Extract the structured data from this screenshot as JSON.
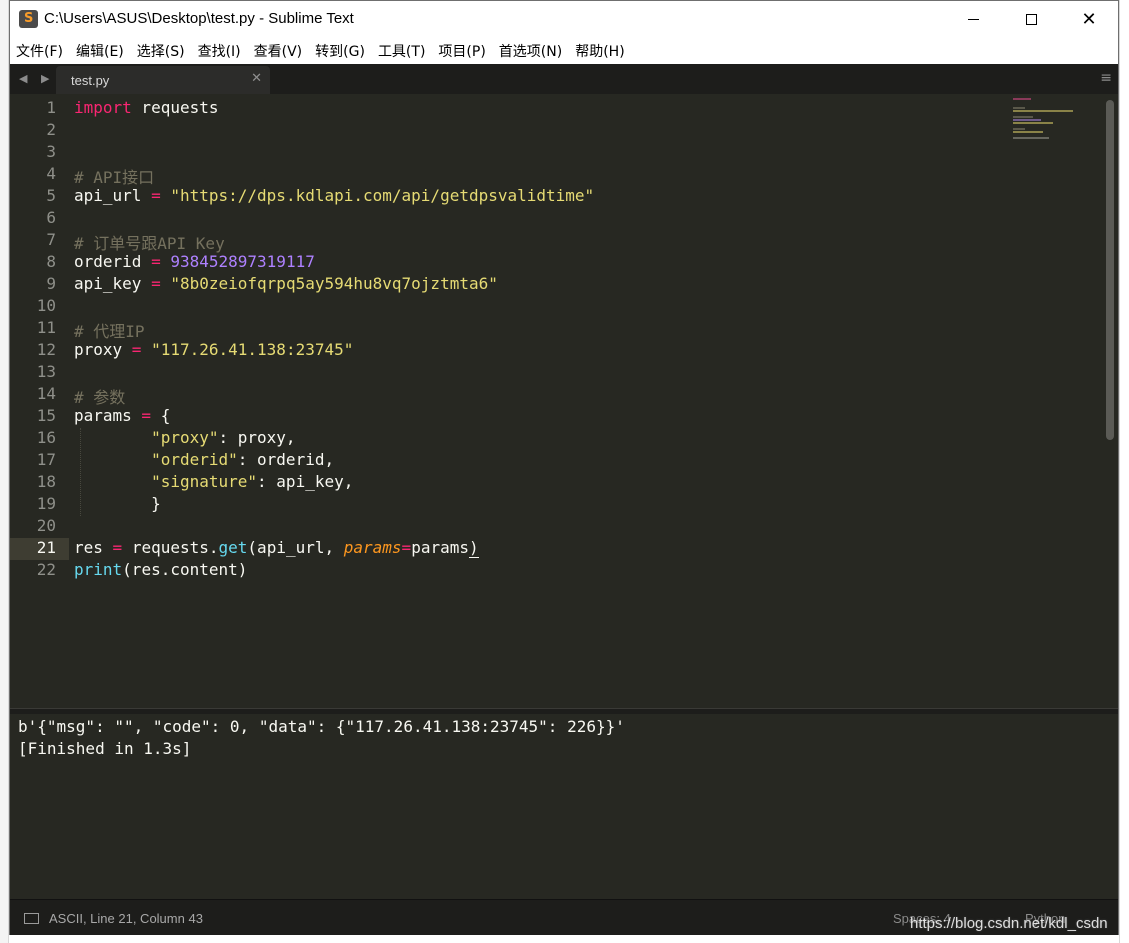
{
  "window": {
    "title": "C:\\Users\\ASUS\\Desktop\\test.py - Sublime Text",
    "minimize_glyph": "",
    "maximize_glyph": "",
    "close_glyph": "✕"
  },
  "menu": [
    "文件(F)",
    "编辑(E)",
    "选择(S)",
    "查找(I)",
    "查看(V)",
    "转到(G)",
    "工具(T)",
    "项目(P)",
    "首选项(N)",
    "帮助(H)"
  ],
  "tabs": {
    "nav_glyph": "◀ ▶",
    "active_label": "test.py",
    "close_glyph": "✕",
    "menu_glyph": "≡"
  },
  "editor": {
    "line_numbers": [
      "1",
      "2",
      "3",
      "4",
      "5",
      "6",
      "7",
      "8",
      "9",
      "10",
      "11",
      "12",
      "13",
      "14",
      "15",
      "16",
      "17",
      "18",
      "19",
      "20",
      "21",
      "22"
    ],
    "current_line": 21,
    "code": {
      "l1_kw": "import",
      "l1_rest": " requests",
      "l4": "# API接口",
      "l5_var": "api_url",
      "l5_op": " = ",
      "l5_str": "\"https://dps.kdlapi.com/api/getdpsvalidtime\"",
      "l7": "# 订单号跟API Key",
      "l8_var": "orderid",
      "l8_op": " = ",
      "l8_num": "938452897319117",
      "l9_var": "api_key",
      "l9_op": " = ",
      "l9_str": "\"8b0zeiofqrpq5ay594hu8vq7ojztmta6\"",
      "l11": "# 代理IP",
      "l12_var": "proxy",
      "l12_op": " = ",
      "l12_str": "\"117.26.41.138:23745\"",
      "l14": "# 参数",
      "l15_var": "params",
      "l15_op": " = ",
      "l15_rest": "{",
      "l16_str": "\"proxy\"",
      "l16_rest": ": proxy,",
      "l17_str": "\"orderid\"",
      "l17_rest": ": orderid,",
      "l18_str": "\"signature\"",
      "l18_rest": ": api_key,",
      "l19": "}",
      "l21_a": "res",
      "l21_op": " = ",
      "l21_b": "requests.",
      "l21_fn": "get",
      "l21_c": "(api_url, ",
      "l21_prm": "params",
      "l21_eq": "=",
      "l21_d": "params",
      "l21_e": ")",
      "l22_fn": "print",
      "l22_rest": "(res.content)"
    }
  },
  "output": {
    "lines": [
      "b'{\"msg\": \"\", \"code\": 0, \"data\": {\"117.26.41.138:23745\": 226}}'",
      "[Finished in 1.3s]"
    ]
  },
  "status": {
    "position": "ASCII, Line 21, Column 43",
    "spaces": "Spaces: 4",
    "syntax": "Python"
  },
  "watermark": "https://blog.csdn.net/kdl_csdn",
  "colors": {
    "editor_bg": "#272822",
    "keyword": "#f92672",
    "string": "#e6db74",
    "number": "#ae81ff",
    "comment": "#75715e",
    "function": "#66d9ef",
    "parameter": "#fd971f"
  }
}
